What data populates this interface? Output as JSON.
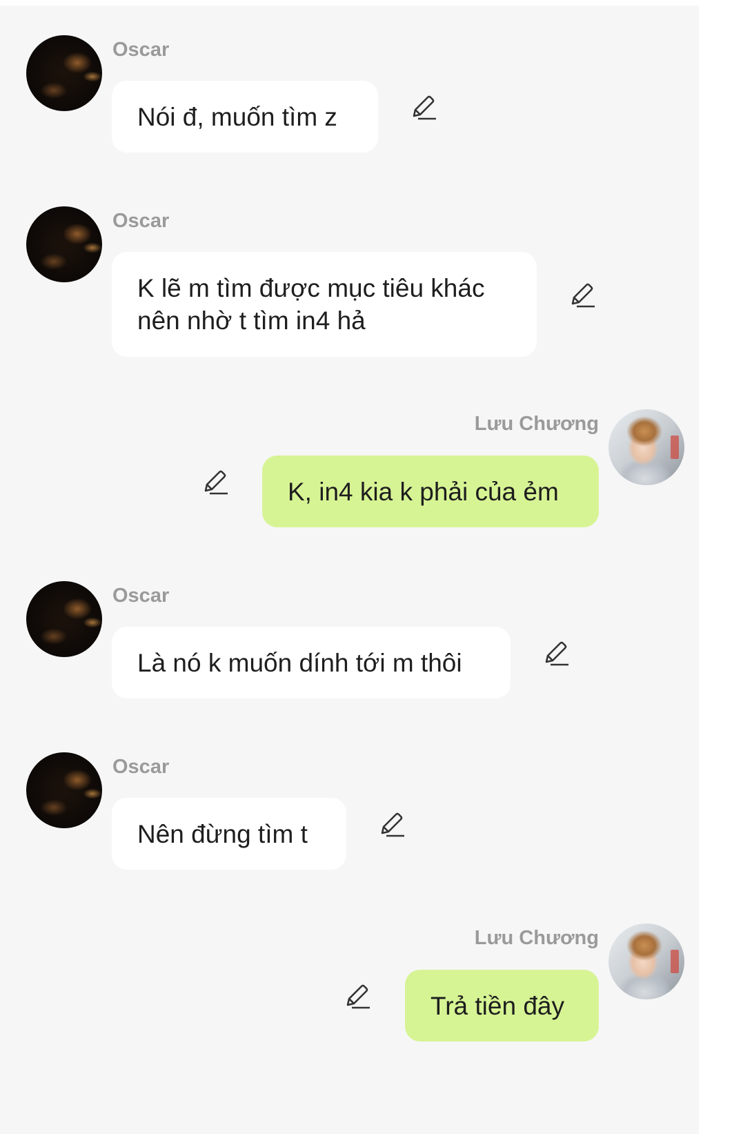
{
  "messages": [
    {
      "sender": "Oscar",
      "text": "Nói đ, muốn tìm z"
    },
    {
      "sender": "Oscar",
      "text": "K lẽ m tìm được mục tiêu khác\nnên nhờ t tìm in4 hả"
    },
    {
      "sender": "Lưu Chương",
      "text": "K, in4 kia k phải của ẻm"
    },
    {
      "sender": "Oscar",
      "text": "Là nó k muốn dính tới m thôi"
    },
    {
      "sender": "Oscar",
      "text": "Nên đừng tìm t"
    },
    {
      "sender": "Lưu Chương",
      "text": "Trả tiền đây"
    }
  ],
  "icons": {
    "avatar_oscar": "dark-portrait-avatar",
    "avatar_luu_chuong": "young-man-portrait-avatar",
    "edit": "pencil-edit-icon"
  },
  "colors": {
    "background": "#f6f6f6",
    "incoming_bubble": "#ffffff",
    "outgoing_bubble": "#d7f495",
    "sender_name": "#9a9a9a",
    "text": "#1e1e1e"
  }
}
